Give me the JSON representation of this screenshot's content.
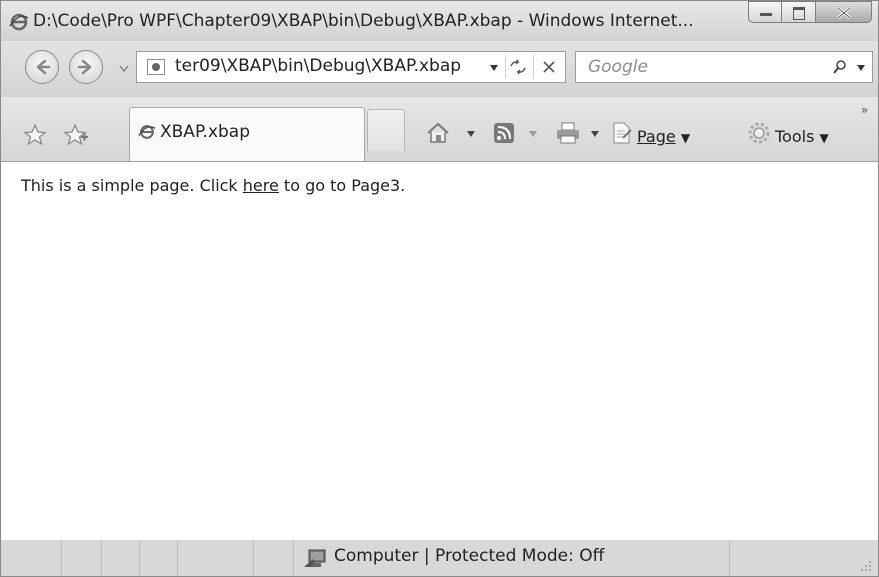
{
  "window": {
    "title": "D:\\Code\\Pro WPF\\Chapter09\\XBAP\\bin\\Debug\\XBAP.xbap - Windows Internet...",
    "buttons": {
      "minimize": "minimize",
      "maximize": "maximize",
      "close": "close"
    }
  },
  "navbar": {
    "address": "ter09\\XBAP\\bin\\Debug\\XBAP.xbap",
    "search_placeholder": "Google"
  },
  "cmdbar": {
    "tab_label": "XBAP.xbap",
    "page_menu": "Page",
    "tools_menu": "Tools",
    "chevron": "»"
  },
  "content": {
    "text_before": "This is a simple page. Click ",
    "link_text": "here",
    "text_after": " to go to Page3."
  },
  "statusbar": {
    "zone_text": "Computer | Protected Mode: Off"
  },
  "colors": {
    "chrome": "#d4d4d4",
    "content_bg": "#ffffff",
    "text": "#222222"
  }
}
